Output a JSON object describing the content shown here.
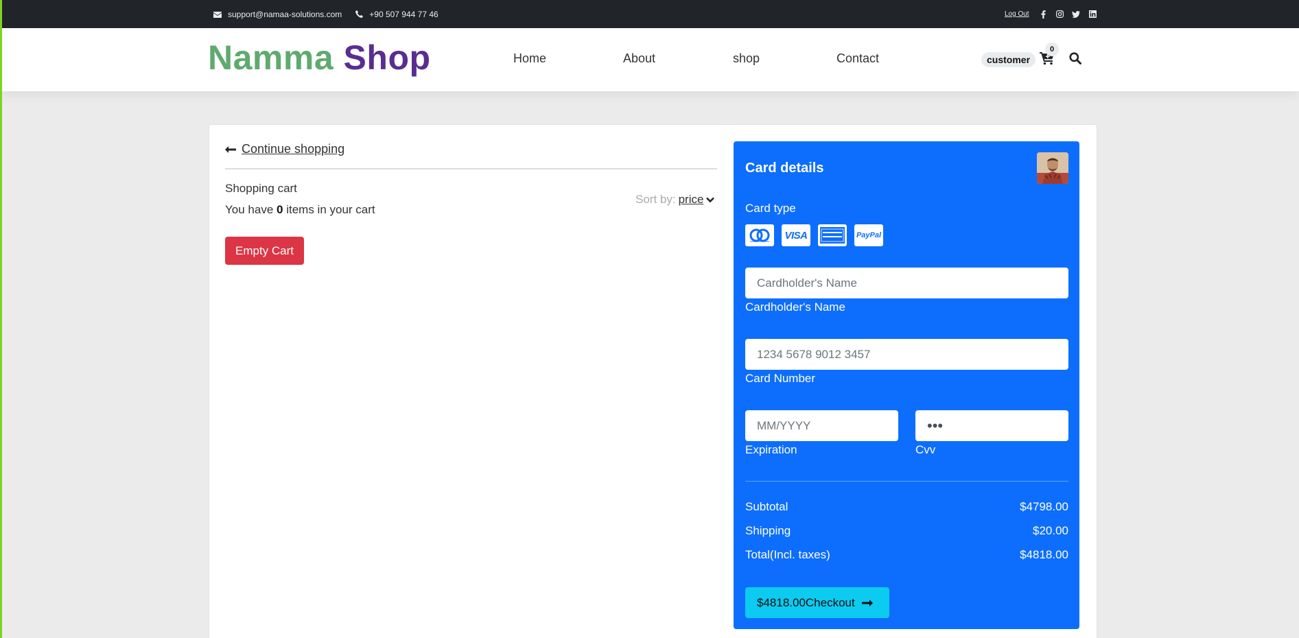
{
  "topbar": {
    "email": "support@namaa-solutions.com",
    "phone": "+90 507 944 77 46",
    "logout": "Log Out"
  },
  "header": {
    "logo_part1": "Namma",
    "logo_part2": "Shop",
    "nav": [
      "Home",
      "About",
      "shop",
      "Contact"
    ],
    "user_badge": "customer",
    "cart_count": "0"
  },
  "cart": {
    "continue_label": "Continue shopping",
    "title": "Shopping cart",
    "sub_prefix": "You have",
    "item_count": "0",
    "sub_suffix": "items in your cart",
    "sort_label": "Sort by:",
    "sort_value": "price",
    "empty_button": "Empty Cart"
  },
  "payment": {
    "title": "Card details",
    "card_type_label": "Card type",
    "card_icons": [
      "mastercard-icon",
      "visa-icon",
      "amex-icon",
      "paypal-icon"
    ],
    "name_placeholder": "Cardholder's Name",
    "name_label": "Cardholder's Name",
    "number_placeholder": "1234 5678 9012 3457",
    "number_label": "Card Number",
    "exp_placeholder": "MM/YYYY",
    "exp_label": "Expiration",
    "cvv_value": "•••",
    "cvv_label": "Cvv",
    "subtotal_label": "Subtotal",
    "subtotal_value": "$4798.00",
    "shipping_label": "Shipping",
    "shipping_value": "$20.00",
    "total_label": "Total(Incl. taxes)",
    "total_value": "$4818.00",
    "checkout_label": "$4818.00Checkout"
  },
  "colors": {
    "panel": "#0d6efd",
    "checkout": "#0dcaf0",
    "empty": "#dc3545",
    "logo_green": "#5faa6f",
    "logo_purple": "#5a2d91"
  }
}
